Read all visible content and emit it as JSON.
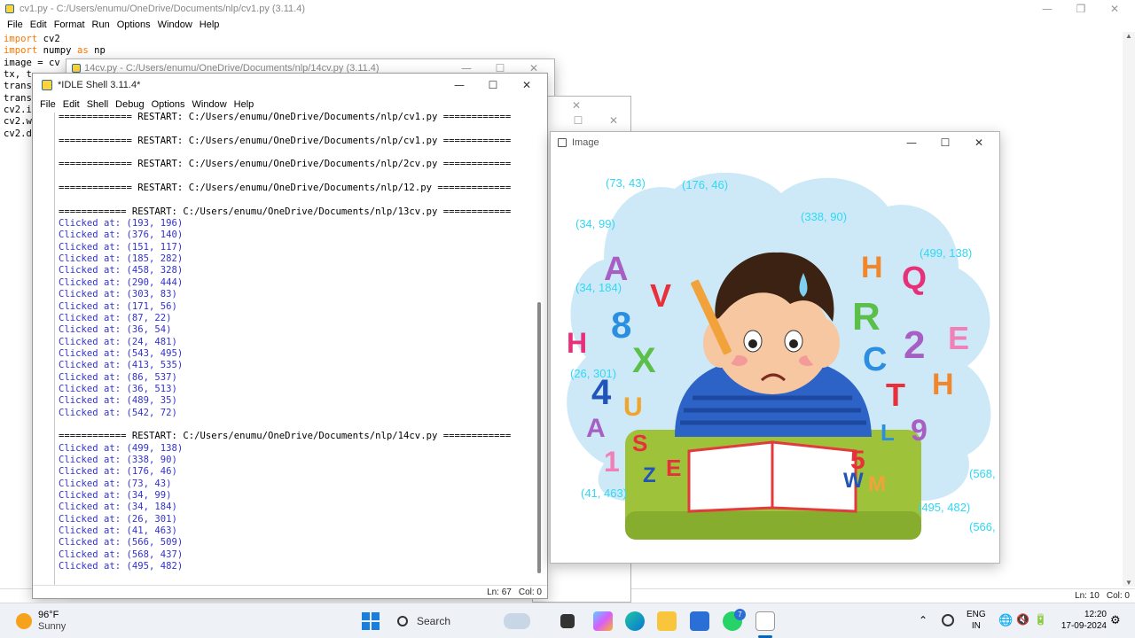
{
  "editor_back": {
    "title": "cv1.py - C:/Users/enumu/OneDrive/Documents/nlp/cv1.py (3.11.4)",
    "menu": [
      "File",
      "Edit",
      "Format",
      "Run",
      "Options",
      "Window",
      "Help"
    ],
    "code_lines": [
      "import cv2",
      "import numpy as np",
      "image = cv",
      "tx, t",
      "trans",
      "trans",
      "cv2.i",
      "cv2.w",
      "cv2.d"
    ],
    "status_line": "Ln: 10",
    "status_col": "Col: 0"
  },
  "editor_mid": {
    "title": "14cv.py - C:/Users/enumu/OneDrive/Documents/nlp/14cv.py (3.11.4)"
  },
  "shell": {
    "title": "*IDLE Shell 3.11.4*",
    "menu": [
      "File",
      "Edit",
      "Shell",
      "Debug",
      "Options",
      "Window",
      "Help"
    ],
    "lines": [
      {
        "t": "============= RESTART: C:/Users/enumu/OneDrive/Documents/nlp/cv1.py ============",
        "k": "r"
      },
      {
        "t": "",
        "k": "b"
      },
      {
        "t": "============= RESTART: C:/Users/enumu/OneDrive/Documents/nlp/cv1.py ============",
        "k": "r"
      },
      {
        "t": "",
        "k": "b"
      },
      {
        "t": "============= RESTART: C:/Users/enumu/OneDrive/Documents/nlp/2cv.py ============",
        "k": "r"
      },
      {
        "t": "",
        "k": "b"
      },
      {
        "t": "============= RESTART: C:/Users/enumu/OneDrive/Documents/nlp/12.py =============",
        "k": "r"
      },
      {
        "t": "",
        "k": "b"
      },
      {
        "t": "============ RESTART: C:/Users/enumu/OneDrive/Documents/nlp/13cv.py ============",
        "k": "r"
      },
      {
        "t": "Clicked at: (193, 196)",
        "k": "o"
      },
      {
        "t": "Clicked at: (376, 140)",
        "k": "o"
      },
      {
        "t": "Clicked at: (151, 117)",
        "k": "o"
      },
      {
        "t": "Clicked at: (185, 282)",
        "k": "o"
      },
      {
        "t": "Clicked at: (458, 328)",
        "k": "o"
      },
      {
        "t": "Clicked at: (290, 444)",
        "k": "o"
      },
      {
        "t": "Clicked at: (303, 83)",
        "k": "o"
      },
      {
        "t": "Clicked at: (171, 56)",
        "k": "o"
      },
      {
        "t": "Clicked at: (87, 22)",
        "k": "o"
      },
      {
        "t": "Clicked at: (36, 54)",
        "k": "o"
      },
      {
        "t": "Clicked at: (24, 481)",
        "k": "o"
      },
      {
        "t": "Clicked at: (543, 495)",
        "k": "o"
      },
      {
        "t": "Clicked at: (413, 535)",
        "k": "o"
      },
      {
        "t": "Clicked at: (86, 537)",
        "k": "o"
      },
      {
        "t": "Clicked at: (36, 513)",
        "k": "o"
      },
      {
        "t": "Clicked at: (489, 35)",
        "k": "o"
      },
      {
        "t": "Clicked at: (542, 72)",
        "k": "o"
      },
      {
        "t": "",
        "k": "b"
      },
      {
        "t": "============ RESTART: C:/Users/enumu/OneDrive/Documents/nlp/14cv.py ============",
        "k": "r"
      },
      {
        "t": "Clicked at: (499, 138)",
        "k": "o"
      },
      {
        "t": "Clicked at: (338, 90)",
        "k": "o"
      },
      {
        "t": "Clicked at: (176, 46)",
        "k": "o"
      },
      {
        "t": "Clicked at: (73, 43)",
        "k": "o"
      },
      {
        "t": "Clicked at: (34, 99)",
        "k": "o"
      },
      {
        "t": "Clicked at: (34, 184)",
        "k": "o"
      },
      {
        "t": "Clicked at: (26, 301)",
        "k": "o"
      },
      {
        "t": "Clicked at: (41, 463)",
        "k": "o"
      },
      {
        "t": "Clicked at: (566, 509)",
        "k": "o"
      },
      {
        "t": "Clicked at: (568, 437)",
        "k": "o"
      },
      {
        "t": "Clicked at: (495, 482)",
        "k": "o"
      }
    ],
    "status_line": "Ln: 67",
    "status_col": "Col: 0"
  },
  "image_window": {
    "title": "Image",
    "labels": [
      "(73, 43)",
      "(176, 46)",
      "(34, 99)",
      "(338, 90)",
      "(499, 138)",
      "(34, 184)",
      "(26, 301)",
      "(41, 463)",
      "(568,",
      "(495, 482)",
      "(566,"
    ],
    "letters": [
      "A",
      "V",
      "8",
      "H",
      "X",
      "4",
      "U",
      "A",
      "1",
      "S",
      "E",
      "Z",
      "H",
      "Q",
      "R",
      "E",
      "2",
      "C",
      "T",
      "H",
      "L",
      "9",
      "5",
      "W",
      "M"
    ]
  },
  "taskbar": {
    "weather_temp": "96°F",
    "weather_desc": "Sunny",
    "search_label": "Search",
    "lang_top": "ENG",
    "lang_bottom": "IN",
    "time": "12:20",
    "date": "17-09-2024",
    "badge": "7"
  },
  "colors": {
    "accent": "#0067c0",
    "shell_output": "#3333cc",
    "label_cyan": "#2fd8f5",
    "keyword": "#ff7700"
  }
}
